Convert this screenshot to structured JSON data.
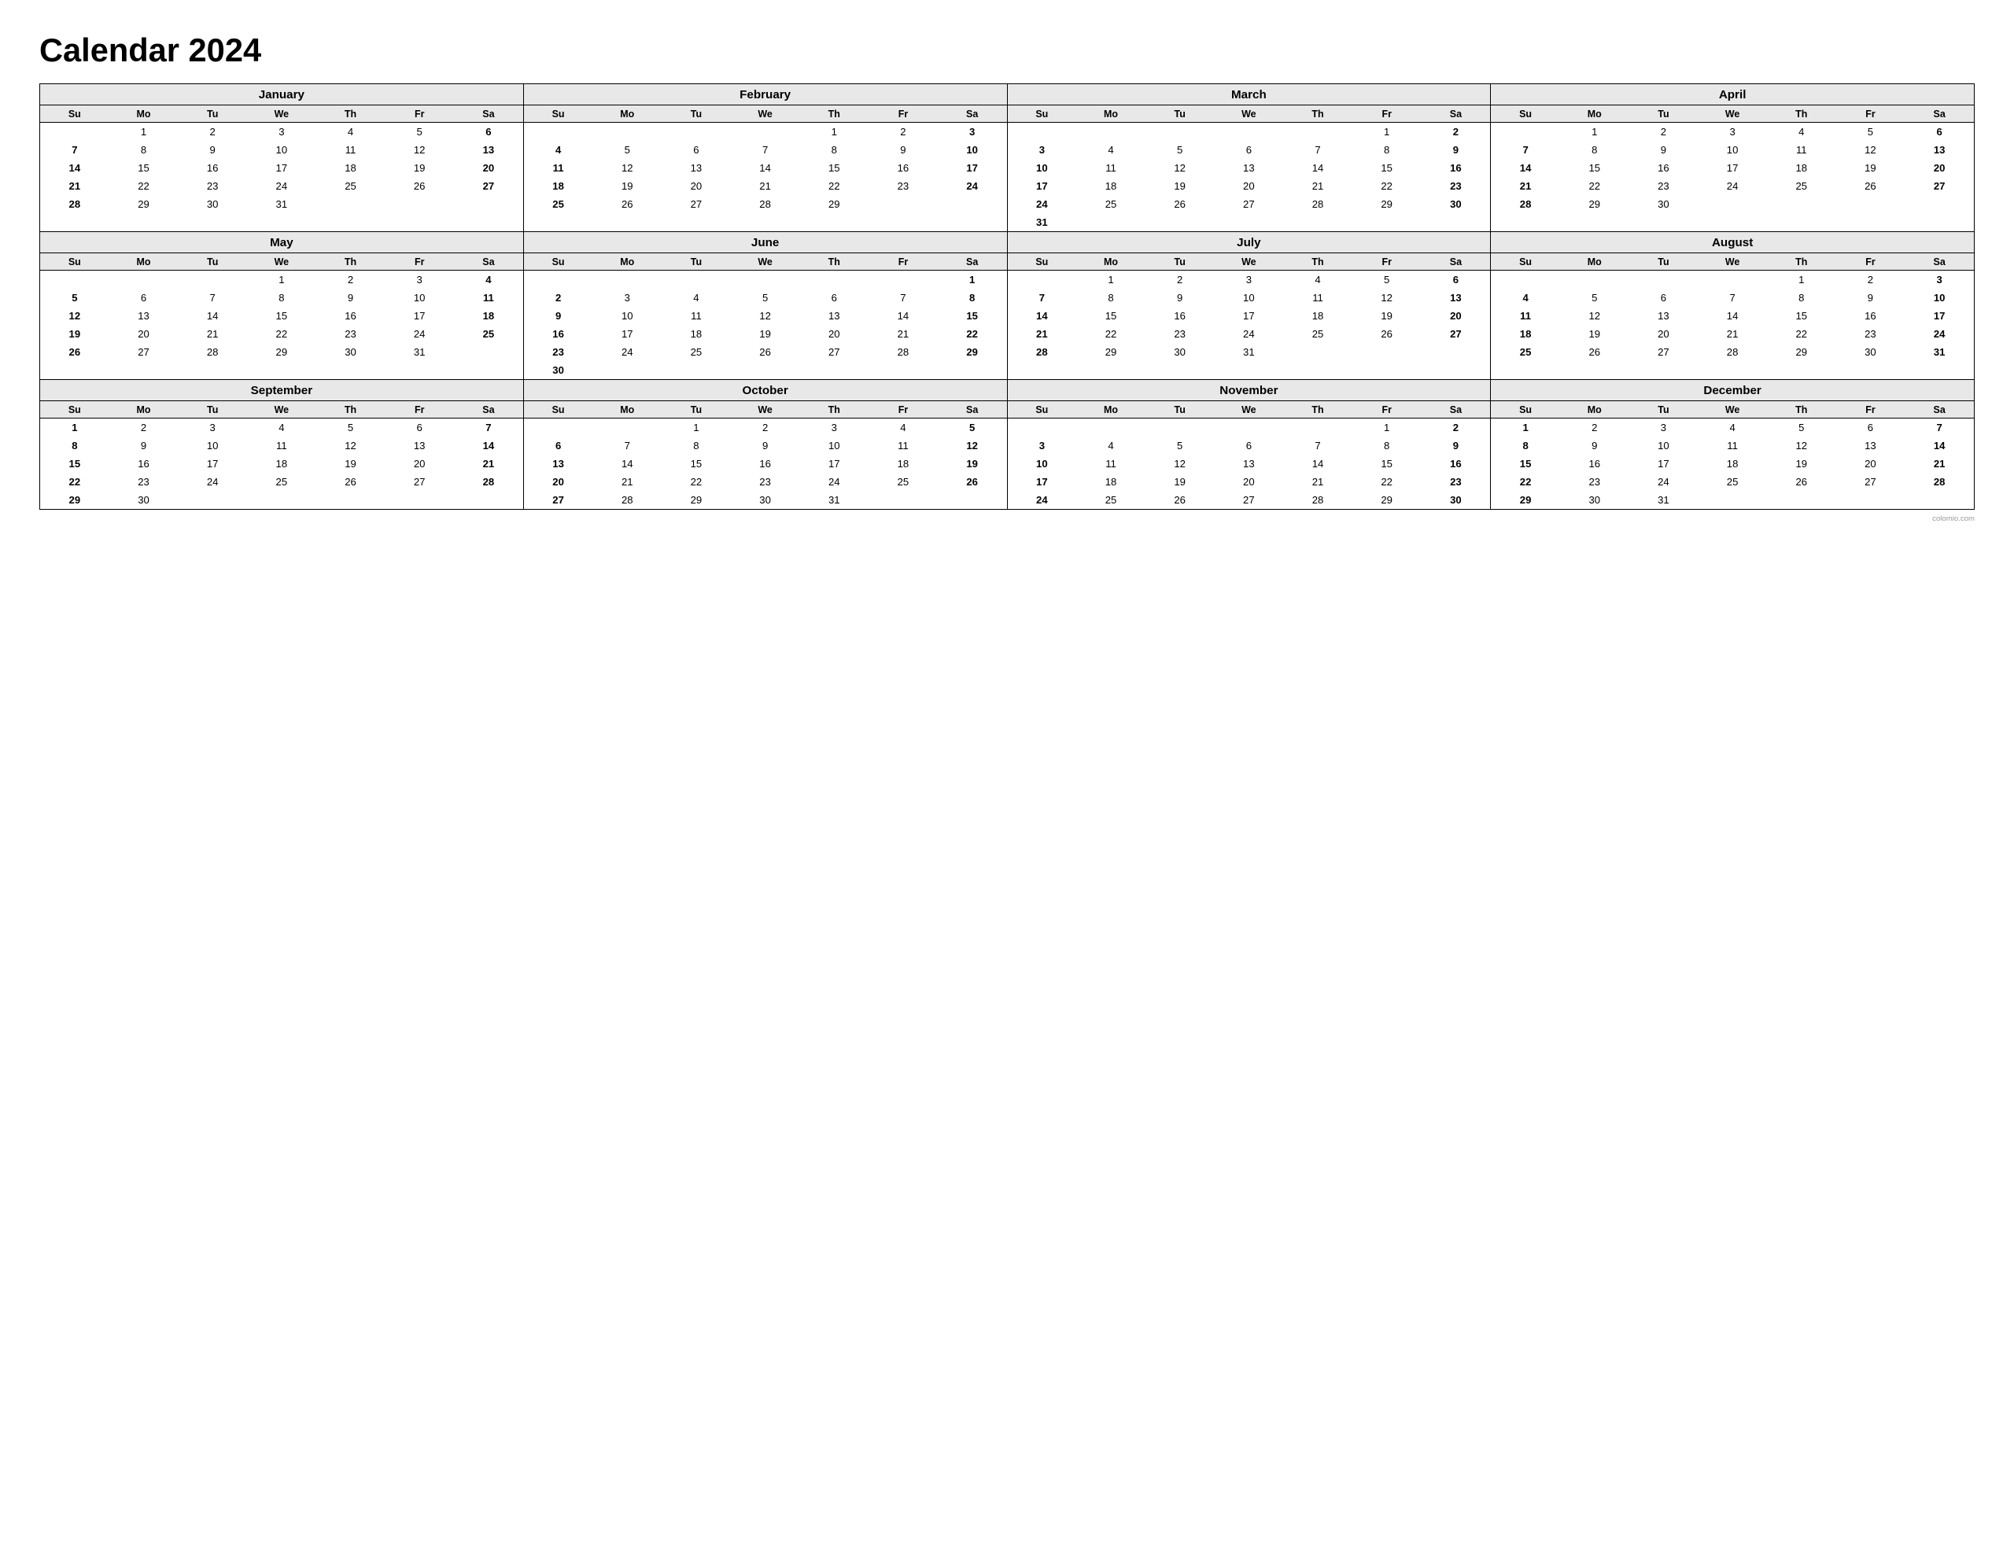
{
  "title": "Calendar 2024",
  "watermark": "colomio.com",
  "days_header": [
    "Su",
    "Mo",
    "Tu",
    "We",
    "Th",
    "Fr",
    "Sa"
  ],
  "months": [
    {
      "name": "January",
      "weeks": [
        [
          "",
          "1",
          "2",
          "3",
          "4",
          "5",
          "6"
        ],
        [
          "7",
          "8",
          "9",
          "10",
          "11",
          "12",
          "13"
        ],
        [
          "14",
          "15",
          "16",
          "17",
          "18",
          "19",
          "20"
        ],
        [
          "21",
          "22",
          "23",
          "24",
          "25",
          "26",
          "27"
        ],
        [
          "28",
          "29",
          "30",
          "31",
          "",
          "",
          ""
        ]
      ]
    },
    {
      "name": "February",
      "weeks": [
        [
          "",
          "",
          "",
          "",
          "1",
          "2",
          "3"
        ],
        [
          "4",
          "5",
          "6",
          "7",
          "8",
          "9",
          "10"
        ],
        [
          "11",
          "12",
          "13",
          "14",
          "15",
          "16",
          "17"
        ],
        [
          "18",
          "19",
          "20",
          "21",
          "22",
          "23",
          "24"
        ],
        [
          "25",
          "26",
          "27",
          "28",
          "29",
          "",
          ""
        ]
      ]
    },
    {
      "name": "March",
      "weeks": [
        [
          "",
          "",
          "",
          "",
          "",
          "1",
          "2"
        ],
        [
          "3",
          "4",
          "5",
          "6",
          "7",
          "8",
          "9"
        ],
        [
          "10",
          "11",
          "12",
          "13",
          "14",
          "15",
          "16"
        ],
        [
          "17",
          "18",
          "19",
          "20",
          "21",
          "22",
          "23"
        ],
        [
          "24",
          "25",
          "26",
          "27",
          "28",
          "29",
          "30"
        ],
        [
          "31",
          "",
          "",
          "",
          "",
          "",
          ""
        ]
      ]
    },
    {
      "name": "April",
      "weeks": [
        [
          "",
          "1",
          "2",
          "3",
          "4",
          "5",
          "6"
        ],
        [
          "7",
          "8",
          "9",
          "10",
          "11",
          "12",
          "13"
        ],
        [
          "14",
          "15",
          "16",
          "17",
          "18",
          "19",
          "20"
        ],
        [
          "21",
          "22",
          "23",
          "24",
          "25",
          "26",
          "27"
        ],
        [
          "28",
          "29",
          "30",
          "",
          "",
          "",
          ""
        ]
      ]
    },
    {
      "name": "May",
      "weeks": [
        [
          "",
          "",
          "",
          "1",
          "2",
          "3",
          "4"
        ],
        [
          "5",
          "6",
          "7",
          "8",
          "9",
          "10",
          "11"
        ],
        [
          "12",
          "13",
          "14",
          "15",
          "16",
          "17",
          "18"
        ],
        [
          "19",
          "20",
          "21",
          "22",
          "23",
          "24",
          "25"
        ],
        [
          "26",
          "27",
          "28",
          "29",
          "30",
          "31",
          ""
        ]
      ]
    },
    {
      "name": "June",
      "weeks": [
        [
          "",
          "",
          "",
          "",
          "",
          "",
          "1"
        ],
        [
          "2",
          "3",
          "4",
          "5",
          "6",
          "7",
          "8"
        ],
        [
          "9",
          "10",
          "11",
          "12",
          "13",
          "14",
          "15"
        ],
        [
          "16",
          "17",
          "18",
          "19",
          "20",
          "21",
          "22"
        ],
        [
          "23",
          "24",
          "25",
          "26",
          "27",
          "28",
          "29"
        ],
        [
          "30",
          "",
          "",
          "",
          "",
          "",
          ""
        ]
      ]
    },
    {
      "name": "July",
      "weeks": [
        [
          "",
          "1",
          "2",
          "3",
          "4",
          "5",
          "6"
        ],
        [
          "7",
          "8",
          "9",
          "10",
          "11",
          "12",
          "13"
        ],
        [
          "14",
          "15",
          "16",
          "17",
          "18",
          "19",
          "20"
        ],
        [
          "21",
          "22",
          "23",
          "24",
          "25",
          "26",
          "27"
        ],
        [
          "28",
          "29",
          "30",
          "31",
          "",
          "",
          ""
        ]
      ]
    },
    {
      "name": "August",
      "weeks": [
        [
          "",
          "",
          "",
          "",
          "1",
          "2",
          "3"
        ],
        [
          "4",
          "5",
          "6",
          "7",
          "8",
          "9",
          "10"
        ],
        [
          "11",
          "12",
          "13",
          "14",
          "15",
          "16",
          "17"
        ],
        [
          "18",
          "19",
          "20",
          "21",
          "22",
          "23",
          "24"
        ],
        [
          "25",
          "26",
          "27",
          "28",
          "29",
          "30",
          "31"
        ]
      ]
    },
    {
      "name": "September",
      "weeks": [
        [
          "1",
          "2",
          "3",
          "4",
          "5",
          "6",
          "7"
        ],
        [
          "8",
          "9",
          "10",
          "11",
          "12",
          "13",
          "14"
        ],
        [
          "15",
          "16",
          "17",
          "18",
          "19",
          "20",
          "21"
        ],
        [
          "22",
          "23",
          "24",
          "25",
          "26",
          "27",
          "28"
        ],
        [
          "29",
          "30",
          "",
          "",
          "",
          "",
          ""
        ]
      ]
    },
    {
      "name": "October",
      "weeks": [
        [
          "",
          "",
          "1",
          "2",
          "3",
          "4",
          "5"
        ],
        [
          "6",
          "7",
          "8",
          "9",
          "10",
          "11",
          "12"
        ],
        [
          "13",
          "14",
          "15",
          "16",
          "17",
          "18",
          "19"
        ],
        [
          "20",
          "21",
          "22",
          "23",
          "24",
          "25",
          "26"
        ],
        [
          "27",
          "28",
          "29",
          "30",
          "31",
          "",
          ""
        ]
      ]
    },
    {
      "name": "November",
      "weeks": [
        [
          "",
          "",
          "",
          "",
          "",
          "1",
          "2"
        ],
        [
          "3",
          "4",
          "5",
          "6",
          "7",
          "8",
          "9"
        ],
        [
          "10",
          "11",
          "12",
          "13",
          "14",
          "15",
          "16"
        ],
        [
          "17",
          "18",
          "19",
          "20",
          "21",
          "22",
          "23"
        ],
        [
          "24",
          "25",
          "26",
          "27",
          "28",
          "29",
          "30"
        ]
      ]
    },
    {
      "name": "December",
      "weeks": [
        [
          "1",
          "2",
          "3",
          "4",
          "5",
          "6",
          "7"
        ],
        [
          "8",
          "9",
          "10",
          "11",
          "12",
          "13",
          "14"
        ],
        [
          "15",
          "16",
          "17",
          "18",
          "19",
          "20",
          "21"
        ],
        [
          "22",
          "23",
          "24",
          "25",
          "26",
          "27",
          "28"
        ],
        [
          "29",
          "30",
          "31",
          "",
          "",
          "",
          ""
        ]
      ]
    }
  ]
}
